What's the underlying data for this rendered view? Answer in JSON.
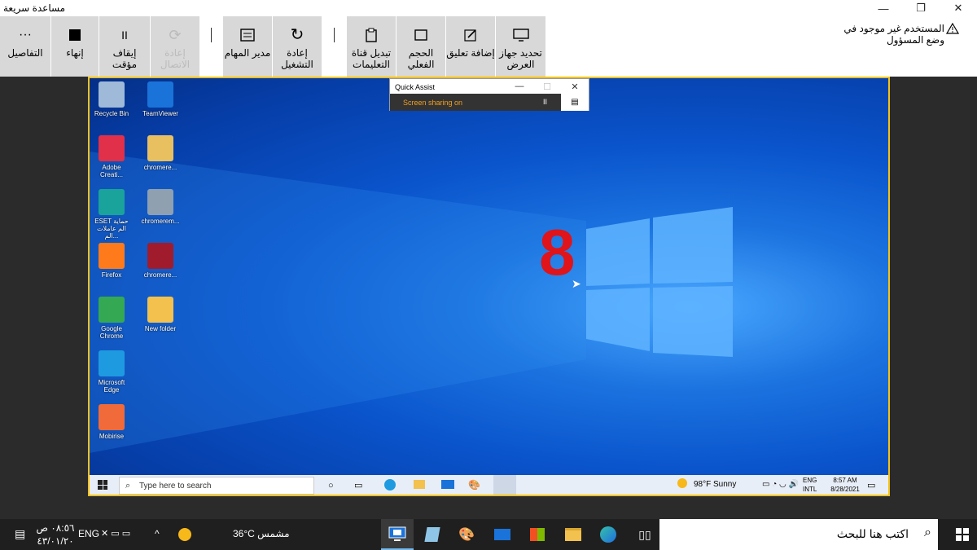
{
  "window": {
    "title": "مساعدة سريعة",
    "min": "—",
    "restore": "❐",
    "close": "✕"
  },
  "toolbar": {
    "details": "التفاصيل",
    "end": "إنهاء",
    "pause": "إيقاف مؤقت",
    "reconnect": "إعادة الاتصال",
    "task_manager": "مدير المهام",
    "restart": "إعادة التشغيل",
    "toggle_channel": "تبديل قناة التعليمات",
    "actual_size": "الحجم الفعلي",
    "annotate": "إضافة تعليق",
    "select_monitor": "تحديد جهاز العرض",
    "warning": "المستخدم غير موجود في وضع المسؤول"
  },
  "remote": {
    "desktop_icons": [
      {
        "label": "Recycle Bin",
        "color": "#9fb9d8"
      },
      {
        "label": "TeamViewer",
        "color": "#1a73d9"
      },
      {
        "label": "Adobe Creati...",
        "color": "#e0304a"
      },
      {
        "label": "chromere...",
        "color": "#e8c060"
      },
      {
        "label": "ESET حماية الم عاملات الم...",
        "color": "#1aa39a"
      },
      {
        "label": "chromerem...",
        "color": "#8fa0b0"
      },
      {
        "label": "Firefox",
        "color": "#ff7a1a"
      },
      {
        "label": "chromere...",
        "color": "#a01c2c"
      },
      {
        "label": "Google Chrome",
        "color": "#34a853"
      },
      {
        "label": "New folder",
        "color": "#f2c14e"
      },
      {
        "label": "Microsoft Edge",
        "color": "#1e9be0"
      },
      {
        "label": "Mobirise",
        "color": "#f06a3a"
      }
    ],
    "quick_assist": {
      "title": "Quick Assist",
      "status": "Screen sharing on",
      "pause": "II"
    },
    "overlay_number": "8",
    "taskbar": {
      "search_placeholder": "Type here to search",
      "weather": "98°F  Sunny",
      "lang_top": "ENG",
      "lang_bottom": "INTL",
      "time": "8:57 AM",
      "date": "8/28/2021"
    }
  },
  "local_taskbar": {
    "search_placeholder": "اكتب هنا للبحث",
    "weather": "36°C  مشمس",
    "lang": "ENG",
    "time": "٠٨:٥٦ ص",
    "date": "٤٣/٠١/٢٠"
  }
}
